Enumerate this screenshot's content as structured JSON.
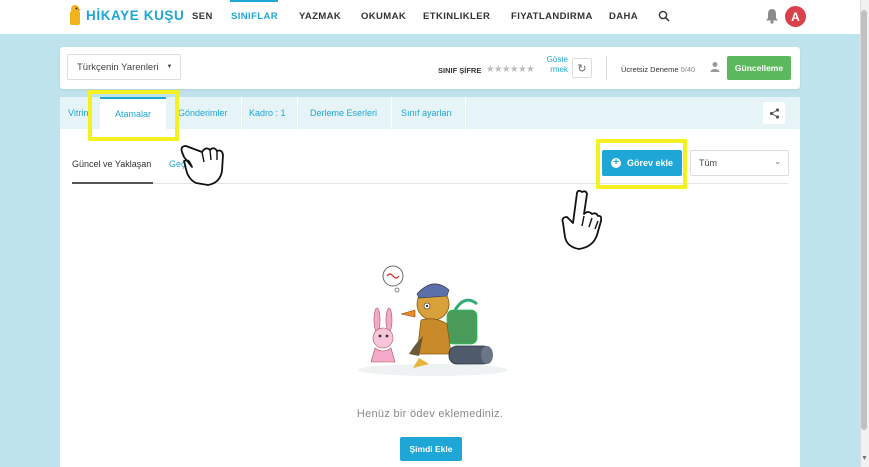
{
  "topnav": {
    "logo_text": "HİKAYE KUŞU",
    "items": [
      {
        "label": "SEN"
      },
      {
        "label": "SINIFLAR",
        "active": true
      },
      {
        "label": "YAZMAK"
      },
      {
        "label": "OKUMAK"
      },
      {
        "label": "ETKINLIKLER"
      },
      {
        "label": "FIYATLANDIRMA"
      },
      {
        "label": "DAHA"
      }
    ],
    "avatar_initial": "A",
    "icons": [
      "search-icon",
      "bell-icon"
    ]
  },
  "class_header": {
    "class_name": "Türkçenin Yarenleri",
    "password_label": "SINIF ŞİFRE",
    "password_masked": "★★★★★★",
    "show_link_line1": "Göste",
    "show_link_line2": "rmek",
    "trial_label": "Ücretsiz Deneme",
    "trial_count": "0/40",
    "upgrade_label": "Güncelleme"
  },
  "tabs": [
    {
      "label": "Vitrin"
    },
    {
      "label": "Atamalar",
      "active": true
    },
    {
      "label": "Gönderimler"
    },
    {
      "label": "Kadro : 1"
    },
    {
      "label": "Derleme Eserleri"
    },
    {
      "label": "Sınıf ayarları"
    }
  ],
  "subtabs": {
    "current": "Güncel ve Yaklaşan",
    "past": "Geçmiş"
  },
  "actions": {
    "add_task_label": "Görev ekle",
    "filter_value": "Tüm"
  },
  "empty_state": {
    "message": "Henüz bir ödev eklemediniz.",
    "add_now_label": "Şimdi Ekle"
  },
  "colors": {
    "accent": "#1ea7d6",
    "success": "#5cb85c",
    "page_bg": "#bfe3ec",
    "highlight": "#f4f122",
    "avatar": "#d9424d"
  }
}
